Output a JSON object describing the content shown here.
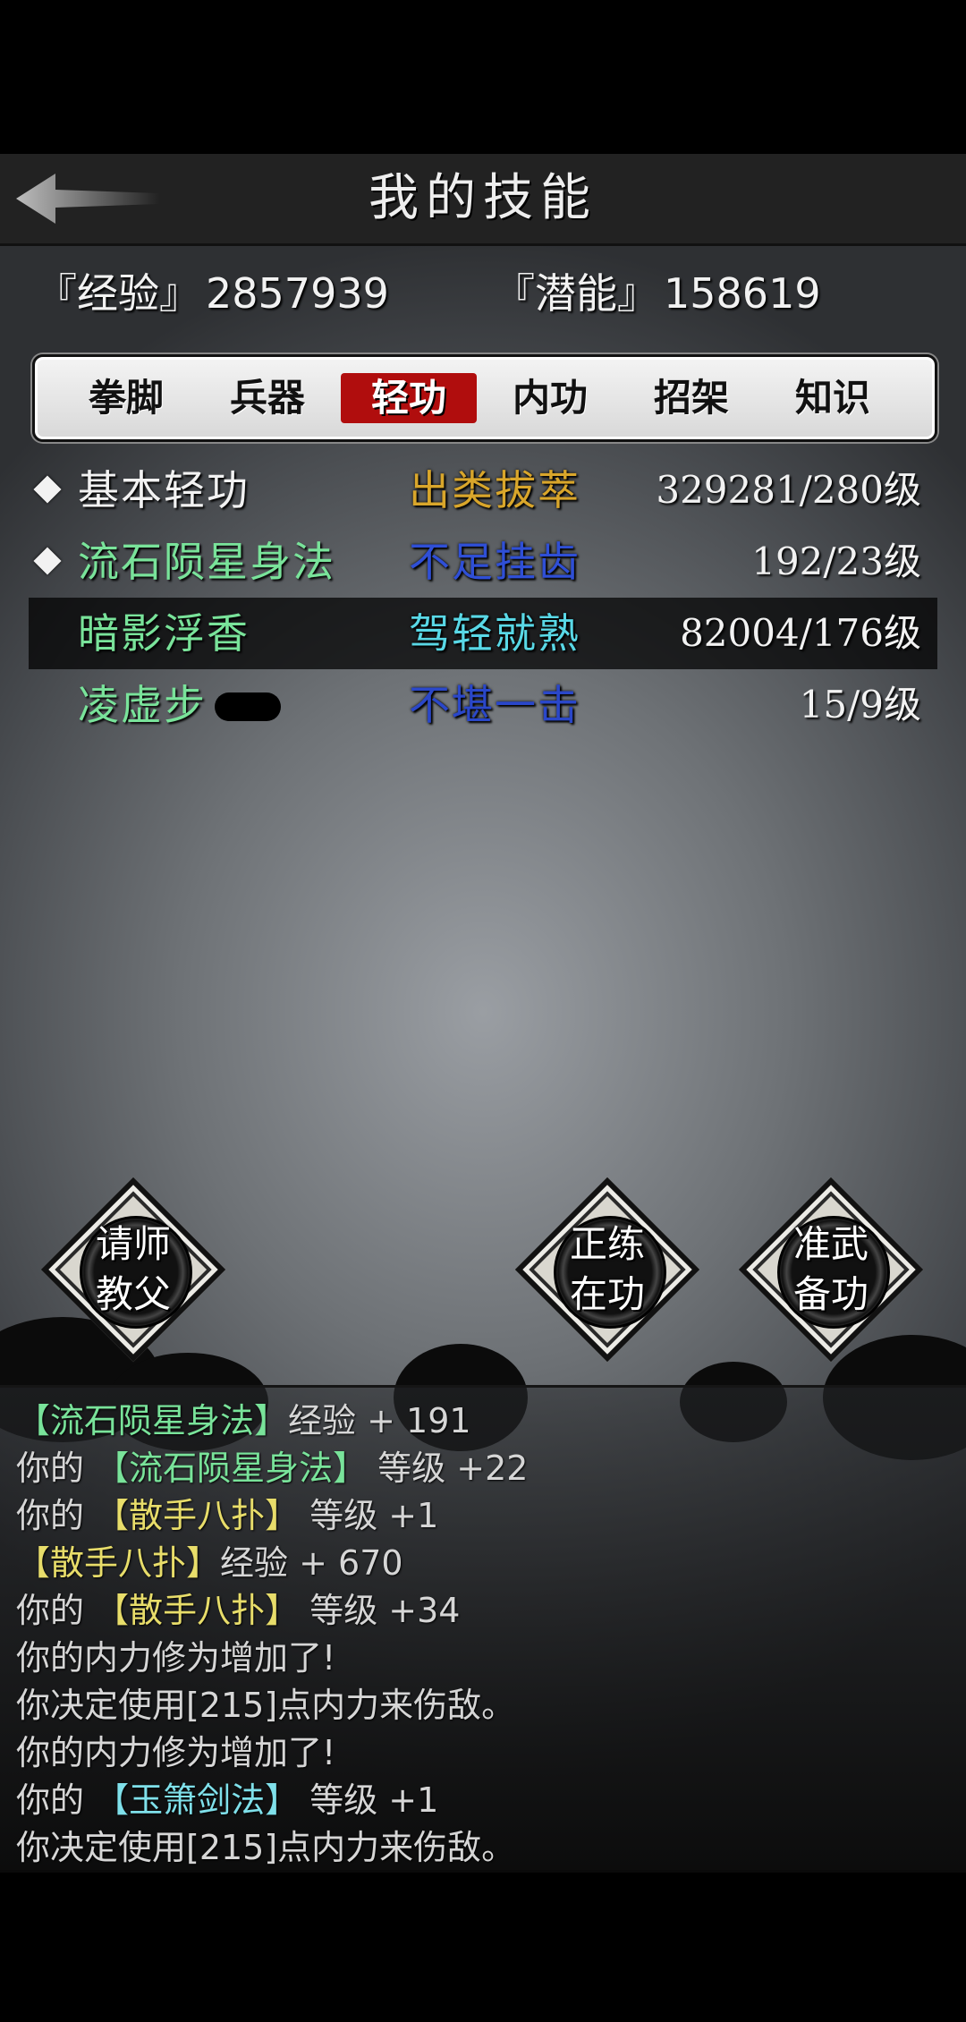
{
  "header": {
    "title": "我的技能",
    "back_icon": "back-arrow-icon"
  },
  "stats": {
    "exp_label": "『经验』",
    "exp_value": "2857939",
    "pot_label": "『潜能』",
    "pot_value": "158619"
  },
  "tabs": [
    {
      "label": "拳脚"
    },
    {
      "label": "兵器"
    },
    {
      "label": "轻功",
      "active": true
    },
    {
      "label": "内功"
    },
    {
      "label": "招架"
    },
    {
      "label": "知识"
    }
  ],
  "skills": [
    {
      "name": "基本轻功",
      "rank": "出类拔萃",
      "level": "329281/280级",
      "name_color": "#f2f2f2",
      "rank_color": "#d9a62b",
      "marked": true
    },
    {
      "name": "流石陨星身法",
      "rank": "不足挂齿",
      "level": "192/23级",
      "name_color": "#79e39a",
      "rank_color": "#2f4fd6",
      "marked": true
    },
    {
      "name": "暗影浮香",
      "rank": "驾轻就熟",
      "level": "82004/176级",
      "name_color": "#79e39a",
      "rank_color": "#59d8e6",
      "marked": false
    },
    {
      "name": "凌虚步",
      "rank": "不堪一击",
      "level": "15/9级",
      "name_color": "#79e39a",
      "rank_color": "#2a47c9",
      "marked": false
    }
  ],
  "buttons": {
    "teacher": {
      "line1": "请师",
      "line2": "教父"
    },
    "practice": {
      "line1": "正练",
      "line2": "在功"
    },
    "prepare": {
      "line1": "准武",
      "line2": "备功"
    }
  },
  "log": [
    {
      "parts": [
        {
          "t": "【流石陨星身法】",
          "c": "g"
        },
        {
          "t": "经验 + 191",
          "c": ""
        }
      ]
    },
    {
      "parts": [
        {
          "t": "你的 ",
          "c": ""
        },
        {
          "t": "【流石陨星身法】",
          "c": "g"
        },
        {
          "t": " 等级 +22",
          "c": ""
        }
      ]
    },
    {
      "parts": [
        {
          "t": "你的 ",
          "c": ""
        },
        {
          "t": "【散手八扑】",
          "c": "y"
        },
        {
          "t": " 等级 +1",
          "c": ""
        }
      ]
    },
    {
      "parts": [
        {
          "t": "【散手八扑】",
          "c": "y"
        },
        {
          "t": "经验 + 670",
          "c": ""
        }
      ]
    },
    {
      "parts": [
        {
          "t": "你的 ",
          "c": ""
        },
        {
          "t": "【散手八扑】",
          "c": "y"
        },
        {
          "t": " 等级 +34",
          "c": ""
        }
      ]
    },
    {
      "parts": [
        {
          "t": "你的内力修为增加了!",
          "c": ""
        }
      ]
    },
    {
      "parts": [
        {
          "t": "你决定使用[215]点内力来伤敌。",
          "c": ""
        }
      ]
    },
    {
      "parts": [
        {
          "t": "你的内力修为增加了!",
          "c": ""
        }
      ]
    },
    {
      "parts": [
        {
          "t": "你的 ",
          "c": ""
        },
        {
          "t": "【玉箫剑法】",
          "c": "c"
        },
        {
          "t": " 等级 +1",
          "c": ""
        }
      ]
    },
    {
      "parts": [
        {
          "t": "你决定使用[215]点内力来伤敌。",
          "c": ""
        }
      ]
    }
  ]
}
